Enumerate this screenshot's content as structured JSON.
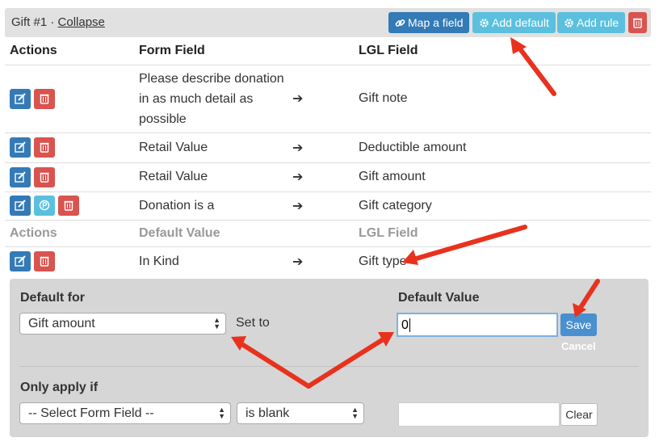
{
  "header": {
    "title": "Gift #1 · ",
    "collapse_link": "Collapse",
    "buttons": {
      "map_field": "Map a field",
      "add_default": "Add default",
      "add_rule": "Add rule"
    }
  },
  "mapping_table": {
    "headers": [
      "Actions",
      "Form Field",
      "LGL Field"
    ],
    "rows": [
      {
        "form_field": "Please describe donation in as much detail as possible",
        "lgl_field": "Gift note"
      },
      {
        "form_field": "Retail Value",
        "lgl_field": "Deductible amount"
      },
      {
        "form_field": "Retail Value",
        "lgl_field": "Gift amount"
      },
      {
        "form_field": "Donation is a",
        "lgl_field": "Gift category"
      }
    ],
    "defaults_headers": [
      "Actions",
      "Default Value",
      "LGL Field"
    ],
    "default_rows": [
      {
        "default_value": "In Kind",
        "lgl_field": "Gift type"
      }
    ],
    "arrow_glyph": "➔"
  },
  "default_form": {
    "default_for_label": "Default for",
    "default_for_selected": "Gift amount",
    "set_to_label": "Set to",
    "default_value_label": "Default Value",
    "default_value_input": "0",
    "save_label": "Save",
    "cancel_label": "Cancel",
    "only_apply_label": "Only apply if",
    "form_field_selected": "-- Select Form Field --",
    "condition_selected": "is blank",
    "condition_value": "",
    "clear_label": "Clear"
  },
  "colors": {
    "primary": "#337ab7",
    "info": "#5bc0de",
    "danger": "#d9534f",
    "annotation_arrow": "#e8321e"
  }
}
